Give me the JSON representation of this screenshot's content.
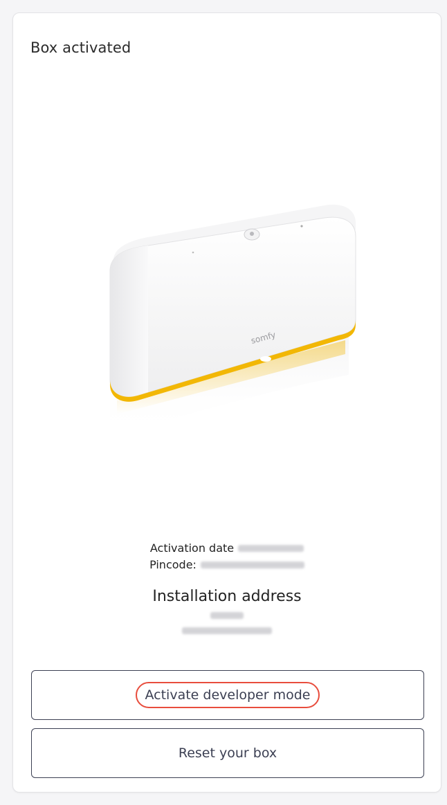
{
  "card": {
    "title": "Box activated"
  },
  "device": {
    "image": "somfy-box-image",
    "brand": "somfy",
    "accent_color": "#f2b705"
  },
  "info": {
    "activation_label": "Activation date",
    "pincode_label": "Pincode:"
  },
  "address": {
    "title": "Installation address"
  },
  "buttons": {
    "developer_mode": "Activate developer mode",
    "reset": "Reset your box"
  },
  "colors": {
    "button_border": "#3b3f52",
    "highlight": "#e84d3d"
  }
}
